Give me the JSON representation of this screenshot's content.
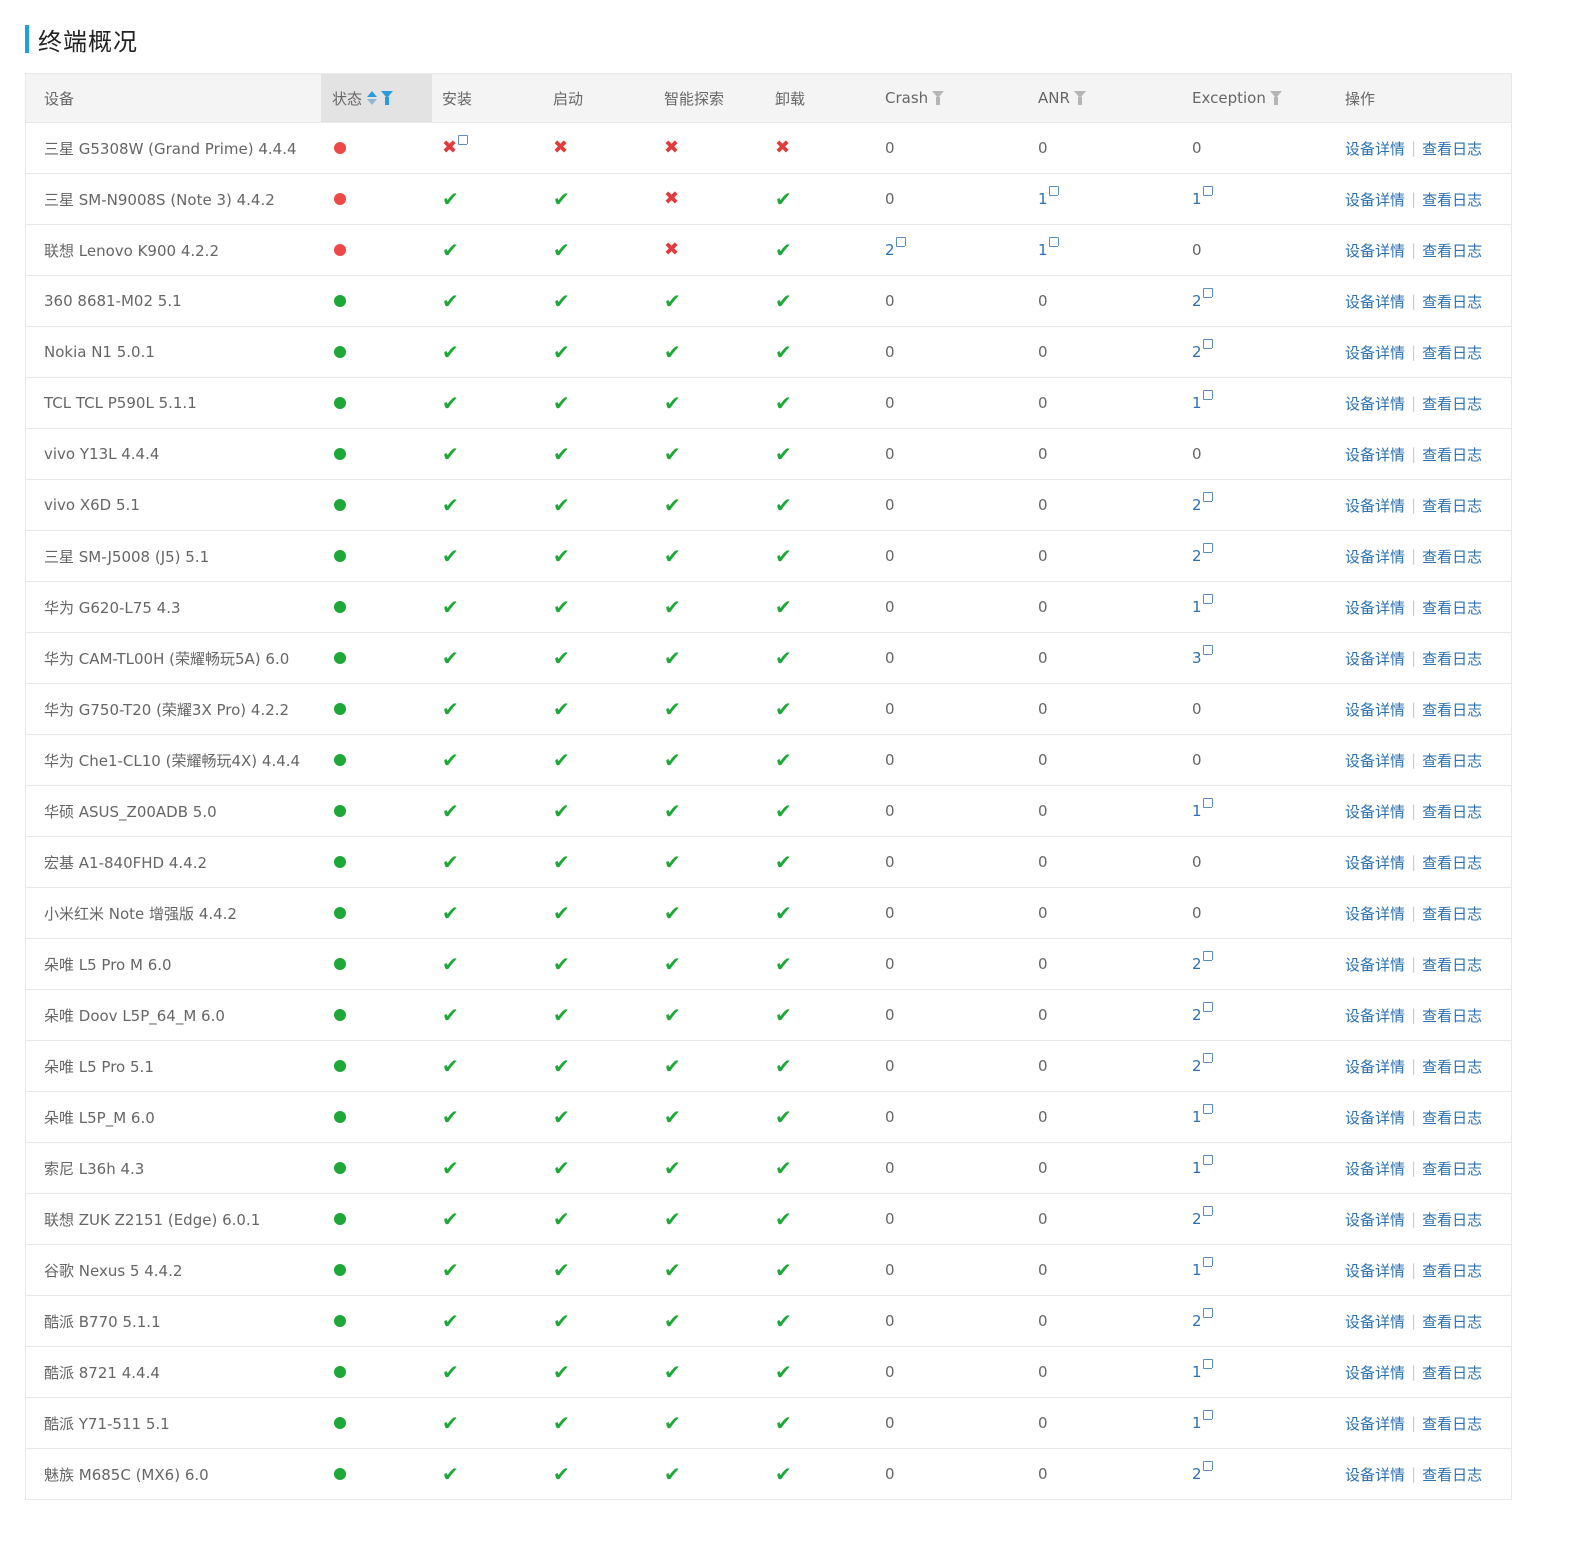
{
  "section": {
    "title": "终端概况"
  },
  "columns": {
    "device": "设备",
    "status": "状态",
    "install": "安装",
    "launch": "启动",
    "explore": "智能探索",
    "uninstall": "卸载",
    "crash": "Crash",
    "anr": "ANR",
    "exception": "Exception",
    "actions": "操作"
  },
  "actions": {
    "detail": "设备详情",
    "log": "查看日志"
  },
  "colors": {
    "accent": "#1e9fe0",
    "ok": "#1ea838",
    "fail": "#e03c3c",
    "link": "#2b71b3"
  },
  "rows": [
    {
      "device": "三星 G5308W (Grand Prime) 4.4.4",
      "status": "red",
      "install": "fail-link",
      "launch": "fail",
      "explore": "fail",
      "uninstall": "fail",
      "crash": "0",
      "crash_link": false,
      "anr": "0",
      "anr_link": false,
      "exception": "0",
      "exception_link": false
    },
    {
      "device": "三星 SM-N9008S (Note 3) 4.4.2",
      "status": "red",
      "install": "ok",
      "launch": "ok",
      "explore": "fail",
      "uninstall": "ok",
      "crash": "0",
      "crash_link": false,
      "anr": "1",
      "anr_link": true,
      "exception": "1",
      "exception_link": true
    },
    {
      "device": "联想 Lenovo K900 4.2.2",
      "status": "red",
      "install": "ok",
      "launch": "ok",
      "explore": "fail",
      "uninstall": "ok",
      "crash": "2",
      "crash_link": true,
      "anr": "1",
      "anr_link": true,
      "exception": "0",
      "exception_link": false
    },
    {
      "device": "360 8681-M02 5.1",
      "status": "green",
      "install": "ok",
      "launch": "ok",
      "explore": "ok",
      "uninstall": "ok",
      "crash": "0",
      "crash_link": false,
      "anr": "0",
      "anr_link": false,
      "exception": "2",
      "exception_link": true
    },
    {
      "device": "Nokia N1 5.0.1",
      "status": "green",
      "install": "ok",
      "launch": "ok",
      "explore": "ok",
      "uninstall": "ok",
      "crash": "0",
      "crash_link": false,
      "anr": "0",
      "anr_link": false,
      "exception": "2",
      "exception_link": true
    },
    {
      "device": "TCL TCL P590L 5.1.1",
      "status": "green",
      "install": "ok",
      "launch": "ok",
      "explore": "ok",
      "uninstall": "ok",
      "crash": "0",
      "crash_link": false,
      "anr": "0",
      "anr_link": false,
      "exception": "1",
      "exception_link": true
    },
    {
      "device": "vivo Y13L 4.4.4",
      "status": "green",
      "install": "ok",
      "launch": "ok",
      "explore": "ok",
      "uninstall": "ok",
      "crash": "0",
      "crash_link": false,
      "anr": "0",
      "anr_link": false,
      "exception": "0",
      "exception_link": false
    },
    {
      "device": "vivo X6D 5.1",
      "status": "green",
      "install": "ok",
      "launch": "ok",
      "explore": "ok",
      "uninstall": "ok",
      "crash": "0",
      "crash_link": false,
      "anr": "0",
      "anr_link": false,
      "exception": "2",
      "exception_link": true
    },
    {
      "device": "三星 SM-J5008 (J5) 5.1",
      "status": "green",
      "install": "ok",
      "launch": "ok",
      "explore": "ok",
      "uninstall": "ok",
      "crash": "0",
      "crash_link": false,
      "anr": "0",
      "anr_link": false,
      "exception": "2",
      "exception_link": true
    },
    {
      "device": "华为 G620-L75 4.3",
      "status": "green",
      "install": "ok",
      "launch": "ok",
      "explore": "ok",
      "uninstall": "ok",
      "crash": "0",
      "crash_link": false,
      "anr": "0",
      "anr_link": false,
      "exception": "1",
      "exception_link": true
    },
    {
      "device": "华为 CAM-TL00H (荣耀畅玩5A) 6.0",
      "status": "green",
      "install": "ok",
      "launch": "ok",
      "explore": "ok",
      "uninstall": "ok",
      "crash": "0",
      "crash_link": false,
      "anr": "0",
      "anr_link": false,
      "exception": "3",
      "exception_link": true
    },
    {
      "device": "华为 G750-T20 (荣耀3X Pro) 4.2.2",
      "status": "green",
      "install": "ok",
      "launch": "ok",
      "explore": "ok",
      "uninstall": "ok",
      "crash": "0",
      "crash_link": false,
      "anr": "0",
      "anr_link": false,
      "exception": "0",
      "exception_link": false
    },
    {
      "device": "华为 Che1-CL10 (荣耀畅玩4X) 4.4.4",
      "status": "green",
      "install": "ok",
      "launch": "ok",
      "explore": "ok",
      "uninstall": "ok",
      "crash": "0",
      "crash_link": false,
      "anr": "0",
      "anr_link": false,
      "exception": "0",
      "exception_link": false
    },
    {
      "device": "华硕 ASUS_Z00ADB 5.0",
      "status": "green",
      "install": "ok",
      "launch": "ok",
      "explore": "ok",
      "uninstall": "ok",
      "crash": "0",
      "crash_link": false,
      "anr": "0",
      "anr_link": false,
      "exception": "1",
      "exception_link": true
    },
    {
      "device": "宏基 A1-840FHD 4.4.2",
      "status": "green",
      "install": "ok",
      "launch": "ok",
      "explore": "ok",
      "uninstall": "ok",
      "crash": "0",
      "crash_link": false,
      "anr": "0",
      "anr_link": false,
      "exception": "0",
      "exception_link": false
    },
    {
      "device": "小米红米 Note 增强版 4.4.2",
      "status": "green",
      "install": "ok",
      "launch": "ok",
      "explore": "ok",
      "uninstall": "ok",
      "crash": "0",
      "crash_link": false,
      "anr": "0",
      "anr_link": false,
      "exception": "0",
      "exception_link": false
    },
    {
      "device": "朵唯 L5 Pro M 6.0",
      "status": "green",
      "install": "ok",
      "launch": "ok",
      "explore": "ok",
      "uninstall": "ok",
      "crash": "0",
      "crash_link": false,
      "anr": "0",
      "anr_link": false,
      "exception": "2",
      "exception_link": true
    },
    {
      "device": "朵唯 Doov L5P_64_M 6.0",
      "status": "green",
      "install": "ok",
      "launch": "ok",
      "explore": "ok",
      "uninstall": "ok",
      "crash": "0",
      "crash_link": false,
      "anr": "0",
      "anr_link": false,
      "exception": "2",
      "exception_link": true
    },
    {
      "device": "朵唯 L5 Pro 5.1",
      "status": "green",
      "install": "ok",
      "launch": "ok",
      "explore": "ok",
      "uninstall": "ok",
      "crash": "0",
      "crash_link": false,
      "anr": "0",
      "anr_link": false,
      "exception": "2",
      "exception_link": true
    },
    {
      "device": "朵唯 L5P_M 6.0",
      "status": "green",
      "install": "ok",
      "launch": "ok",
      "explore": "ok",
      "uninstall": "ok",
      "crash": "0",
      "crash_link": false,
      "anr": "0",
      "anr_link": false,
      "exception": "1",
      "exception_link": true
    },
    {
      "device": "索尼 L36h 4.3",
      "status": "green",
      "install": "ok",
      "launch": "ok",
      "explore": "ok",
      "uninstall": "ok",
      "crash": "0",
      "crash_link": false,
      "anr": "0",
      "anr_link": false,
      "exception": "1",
      "exception_link": true
    },
    {
      "device": "联想 ZUK Z2151 (Edge) 6.0.1",
      "status": "green",
      "install": "ok",
      "launch": "ok",
      "explore": "ok",
      "uninstall": "ok",
      "crash": "0",
      "crash_link": false,
      "anr": "0",
      "anr_link": false,
      "exception": "2",
      "exception_link": true
    },
    {
      "device": "谷歌 Nexus 5 4.4.2",
      "status": "green",
      "install": "ok",
      "launch": "ok",
      "explore": "ok",
      "uninstall": "ok",
      "crash": "0",
      "crash_link": false,
      "anr": "0",
      "anr_link": false,
      "exception": "1",
      "exception_link": true
    },
    {
      "device": "酷派 B770 5.1.1",
      "status": "green",
      "install": "ok",
      "launch": "ok",
      "explore": "ok",
      "uninstall": "ok",
      "crash": "0",
      "crash_link": false,
      "anr": "0",
      "anr_link": false,
      "exception": "2",
      "exception_link": true
    },
    {
      "device": "酷派 8721 4.4.4",
      "status": "green",
      "install": "ok",
      "launch": "ok",
      "explore": "ok",
      "uninstall": "ok",
      "crash": "0",
      "crash_link": false,
      "anr": "0",
      "anr_link": false,
      "exception": "1",
      "exception_link": true
    },
    {
      "device": "酷派 Y71-511 5.1",
      "status": "green",
      "install": "ok",
      "launch": "ok",
      "explore": "ok",
      "uninstall": "ok",
      "crash": "0",
      "crash_link": false,
      "anr": "0",
      "anr_link": false,
      "exception": "1",
      "exception_link": true
    },
    {
      "device": "魅族 M685C (MX6) 6.0",
      "status": "green",
      "install": "ok",
      "launch": "ok",
      "explore": "ok",
      "uninstall": "ok",
      "crash": "0",
      "crash_link": false,
      "anr": "0",
      "anr_link": false,
      "exception": "2",
      "exception_link": true
    }
  ]
}
